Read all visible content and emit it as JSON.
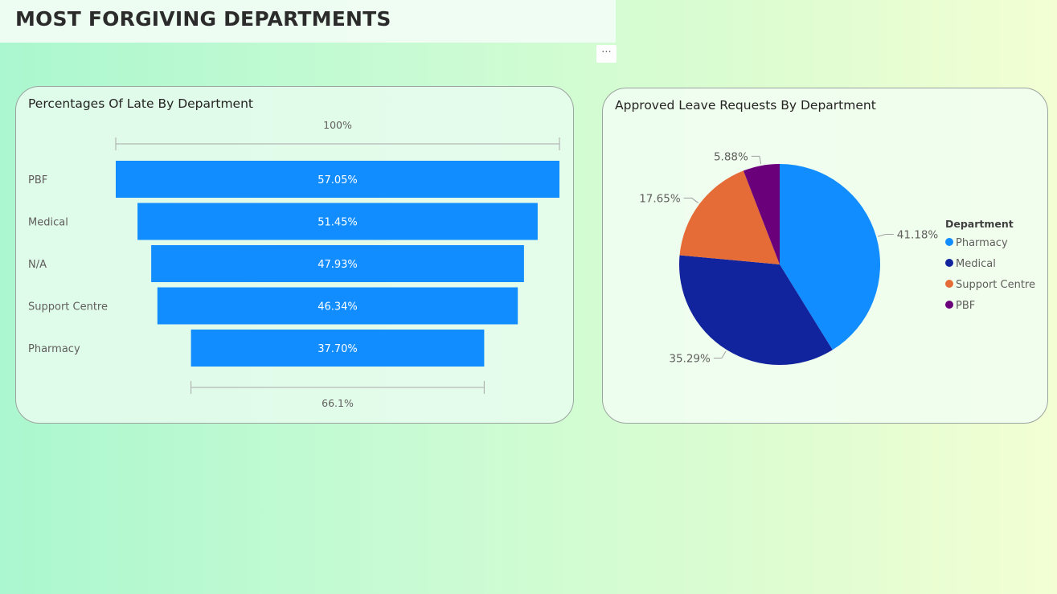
{
  "page": {
    "title": "MOST FORGIVING DEPARTMENTS",
    "more_options_label": "···"
  },
  "funnel": {
    "title": "Percentages Of Late By Department",
    "top_label": "100%",
    "bottom_label": "66.1%"
  },
  "pie": {
    "title": "Approved Leave Requests By Department",
    "legend_title": "Department"
  },
  "colors": {
    "funnel_bar": "#118dff",
    "pharmacy": "#118dff",
    "medical": "#12239e",
    "support_centre": "#e66c37",
    "pbf": "#6b007b"
  },
  "chart_data": [
    {
      "type": "bar",
      "subtype": "funnel",
      "title": "Percentages Of Late By Department",
      "categories": [
        "PBF",
        "Medical",
        "N/A",
        "Support Centre",
        "Pharmacy"
      ],
      "values": [
        57.05,
        51.45,
        47.93,
        46.34,
        37.7
      ],
      "labels": [
        "57.05%",
        "51.45%",
        "47.93%",
        "46.34%",
        "37.70%"
      ],
      "top_conversion_label": "100%",
      "bottom_conversion_label": "66.1%"
    },
    {
      "type": "pie",
      "title": "Approved Leave Requests By Department",
      "legend_title": "Department",
      "legend_position": "right",
      "slices": [
        {
          "name": "Pharmacy",
          "value": 41.18,
          "label": "41.18%",
          "color": "#118dff"
        },
        {
          "name": "Medical",
          "value": 35.29,
          "label": "35.29%",
          "color": "#12239e"
        },
        {
          "name": "Support Centre",
          "value": 17.65,
          "label": "17.65%",
          "color": "#e66c37"
        },
        {
          "name": "PBF",
          "value": 5.88,
          "label": "5.88%",
          "color": "#6b007b"
        }
      ]
    }
  ]
}
